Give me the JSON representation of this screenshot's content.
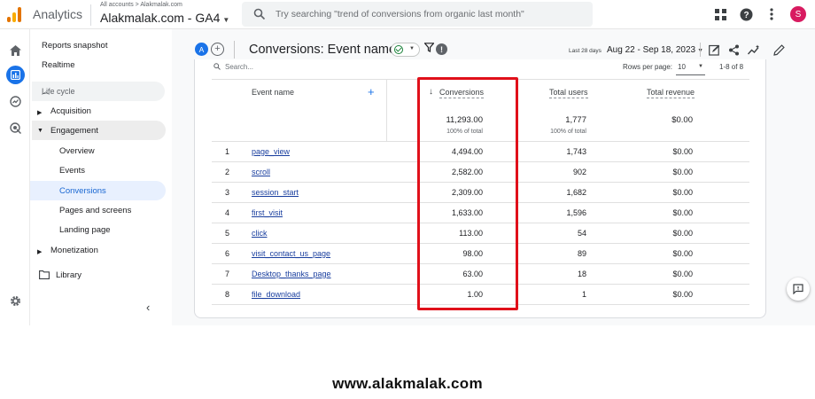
{
  "topbar": {
    "app_name": "Analytics",
    "breadcrumb": "All accounts > Alakmalak.com",
    "property": "Alakmalak.com - GA4",
    "search_placeholder": "Try searching \"trend of conversions from organic last month\"",
    "avatar_letter": "S",
    "icons": [
      "apps-icon",
      "help-icon",
      "more-vert-icon"
    ]
  },
  "rail": {
    "icons": [
      "home-icon",
      "reports-icon",
      "explore-icon",
      "advertising-icon",
      "settings-icon"
    ]
  },
  "nav": {
    "reports_snapshot": "Reports snapshot",
    "realtime": "Realtime",
    "life_cycle": "Life cycle",
    "acquisition": "Acquisition",
    "engagement": "Engagement",
    "engagement_items": [
      "Overview",
      "Events",
      "Conversions",
      "Pages and screens",
      "Landing page"
    ],
    "monetization": "Monetization",
    "library": "Library"
  },
  "report": {
    "comparison_letter": "A",
    "title": "Conversions: Event name",
    "last_days": "Last 28 days",
    "date_range": "Aug 22 - Sep 18, 2023"
  },
  "table": {
    "search_placeholder": "Search...",
    "rows_per_page_label": "Rows per page:",
    "rows_per_page": "10",
    "count": "1-8 of 8",
    "headers": {
      "event_name": "Event name",
      "conversions": "Conversions",
      "total_users": "Total users",
      "total_revenue": "Total revenue"
    },
    "totals": {
      "conversions": "11,293.00",
      "conversions_pct": "100% of total",
      "total_users": "1,777",
      "total_users_pct": "100% of total",
      "total_revenue": "$0.00"
    },
    "rows": [
      {
        "index": "1",
        "event": "page_view",
        "conversions": "4,494.00",
        "users": "1,743",
        "revenue": "$0.00"
      },
      {
        "index": "2",
        "event": "scroll",
        "conversions": "2,582.00",
        "users": "902",
        "revenue": "$0.00"
      },
      {
        "index": "3",
        "event": "session_start",
        "conversions": "2,309.00",
        "users": "1,682",
        "revenue": "$0.00"
      },
      {
        "index": "4",
        "event": "first_visit",
        "conversions": "1,633.00",
        "users": "1,596",
        "revenue": "$0.00"
      },
      {
        "index": "5",
        "event": "click",
        "conversions": "113.00",
        "users": "54",
        "revenue": "$0.00"
      },
      {
        "index": "6",
        "event": "visit_contact_us_page",
        "conversions": "98.00",
        "users": "89",
        "revenue": "$0.00"
      },
      {
        "index": "7",
        "event": "Desktop_thanks_page",
        "conversions": "63.00",
        "users": "18",
        "revenue": "$0.00"
      },
      {
        "index": "8",
        "event": "file_download",
        "conversions": "1.00",
        "users": "1",
        "revenue": "$0.00"
      }
    ]
  },
  "highlight_color": "#e0101a",
  "accent_color": "#1a73e8",
  "footer": {
    "site": "www.alakmalak.com"
  }
}
